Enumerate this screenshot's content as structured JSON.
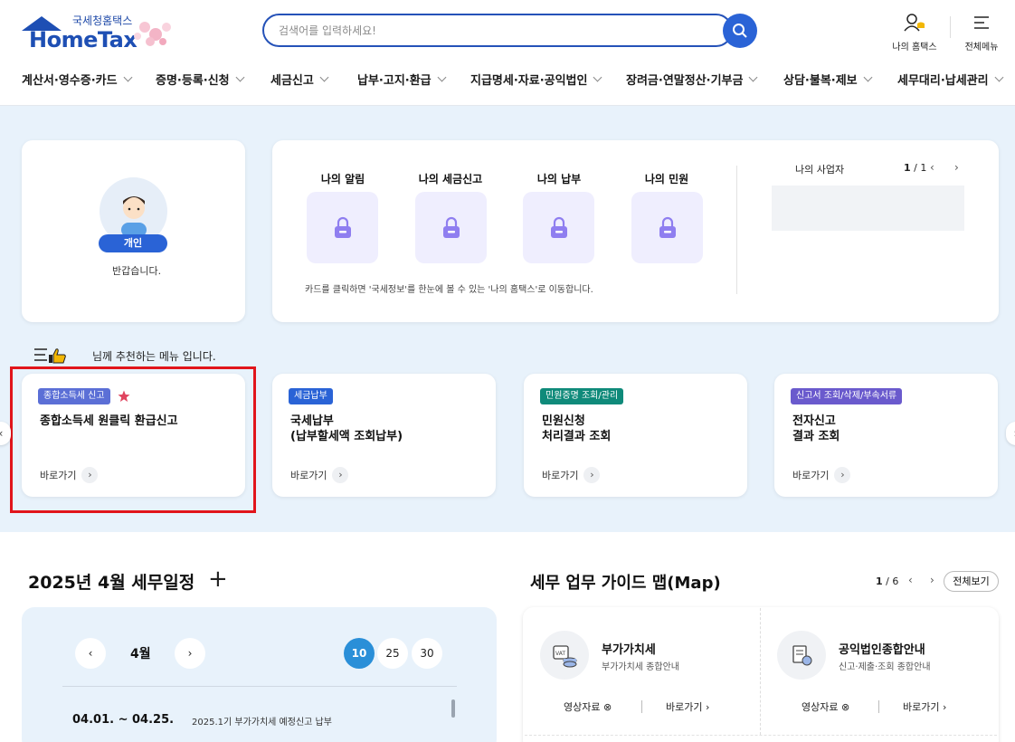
{
  "header": {
    "logo_sub": "국세청홈택스",
    "logo_main": "HomeTax",
    "search_placeholder": "검색어를 입력하세요!",
    "my_hometax": "나의 홈택스",
    "all_menu": "전체메뉴"
  },
  "gnb": [
    {
      "label": "계산서·영수증·카드"
    },
    {
      "label": "증명·등록·신청"
    },
    {
      "label": "세금신고"
    },
    {
      "label": "납부·고지·환급"
    },
    {
      "label": "지급명세·자료·공익법인"
    },
    {
      "label": "장려금·연말정산·기부금"
    },
    {
      "label": "상담·불복·제보"
    },
    {
      "label": "세무대리·납세관리"
    }
  ],
  "profile": {
    "badge": "개인",
    "message": "반갑습니다."
  },
  "info": {
    "items": [
      {
        "label": "나의 알림"
      },
      {
        "label": "나의 세금신고"
      },
      {
        "label": "나의 납부"
      },
      {
        "label": "나의 민원"
      }
    ],
    "note": "카드를 클릭하면 '국세정보'를 한눈에 볼 수 있는 '나의 홈택스'로 이동합니다.",
    "business_title": "나의 사업자",
    "page_current": "1",
    "page_total": "/ 1"
  },
  "recommend": {
    "title": "님께 추천하는 메뉴 입니다.",
    "cards": [
      {
        "tag": "종합소득세 신고",
        "tag_color": "#5b6fd6",
        "name": "종합소득세 원클릭 환급신고",
        "go": "바로가기"
      },
      {
        "tag": "세금납부",
        "tag_color": "#2a63d6",
        "name": "국세납부\n(납부할세액 조회납부)",
        "go": "바로가기"
      },
      {
        "tag": "민원증명 조회/관리",
        "tag_color": "#0f8a7a",
        "name": "민원신청\n처리결과 조회",
        "go": "바로가기"
      },
      {
        "tag": "신고서 조회/삭제/부속서류",
        "tag_color": "#6a5acd",
        "name": "전자신고\n결과 조회",
        "go": "바로가기"
      }
    ]
  },
  "schedule": {
    "title": "2025년 4월 세무일정",
    "month": "4월",
    "days": [
      "10",
      "25",
      "30"
    ],
    "active_day": "10",
    "date": "04.01. ~ 04.25.",
    "desc": "2025.1기 부가가치세 예정신고 납부"
  },
  "guide": {
    "title": "세무 업무 가이드 맵(Map)",
    "page_current": "1",
    "page_total": "/ 6",
    "all_view": "전체보기",
    "items": [
      {
        "name": "부가가치세",
        "desc": "부가가치세 종합안내",
        "video": "영상자료",
        "go": "바로가기"
      },
      {
        "name": "공익법인종합안내",
        "desc": "신고·제출·조회 종합안내",
        "video": "영상자료",
        "go": "바로가기"
      }
    ]
  },
  "colors": {
    "brand": "#1e4fb4",
    "accent": "#2a63d6",
    "highlight": "#e1151b",
    "bg": "#e8f2fb"
  }
}
